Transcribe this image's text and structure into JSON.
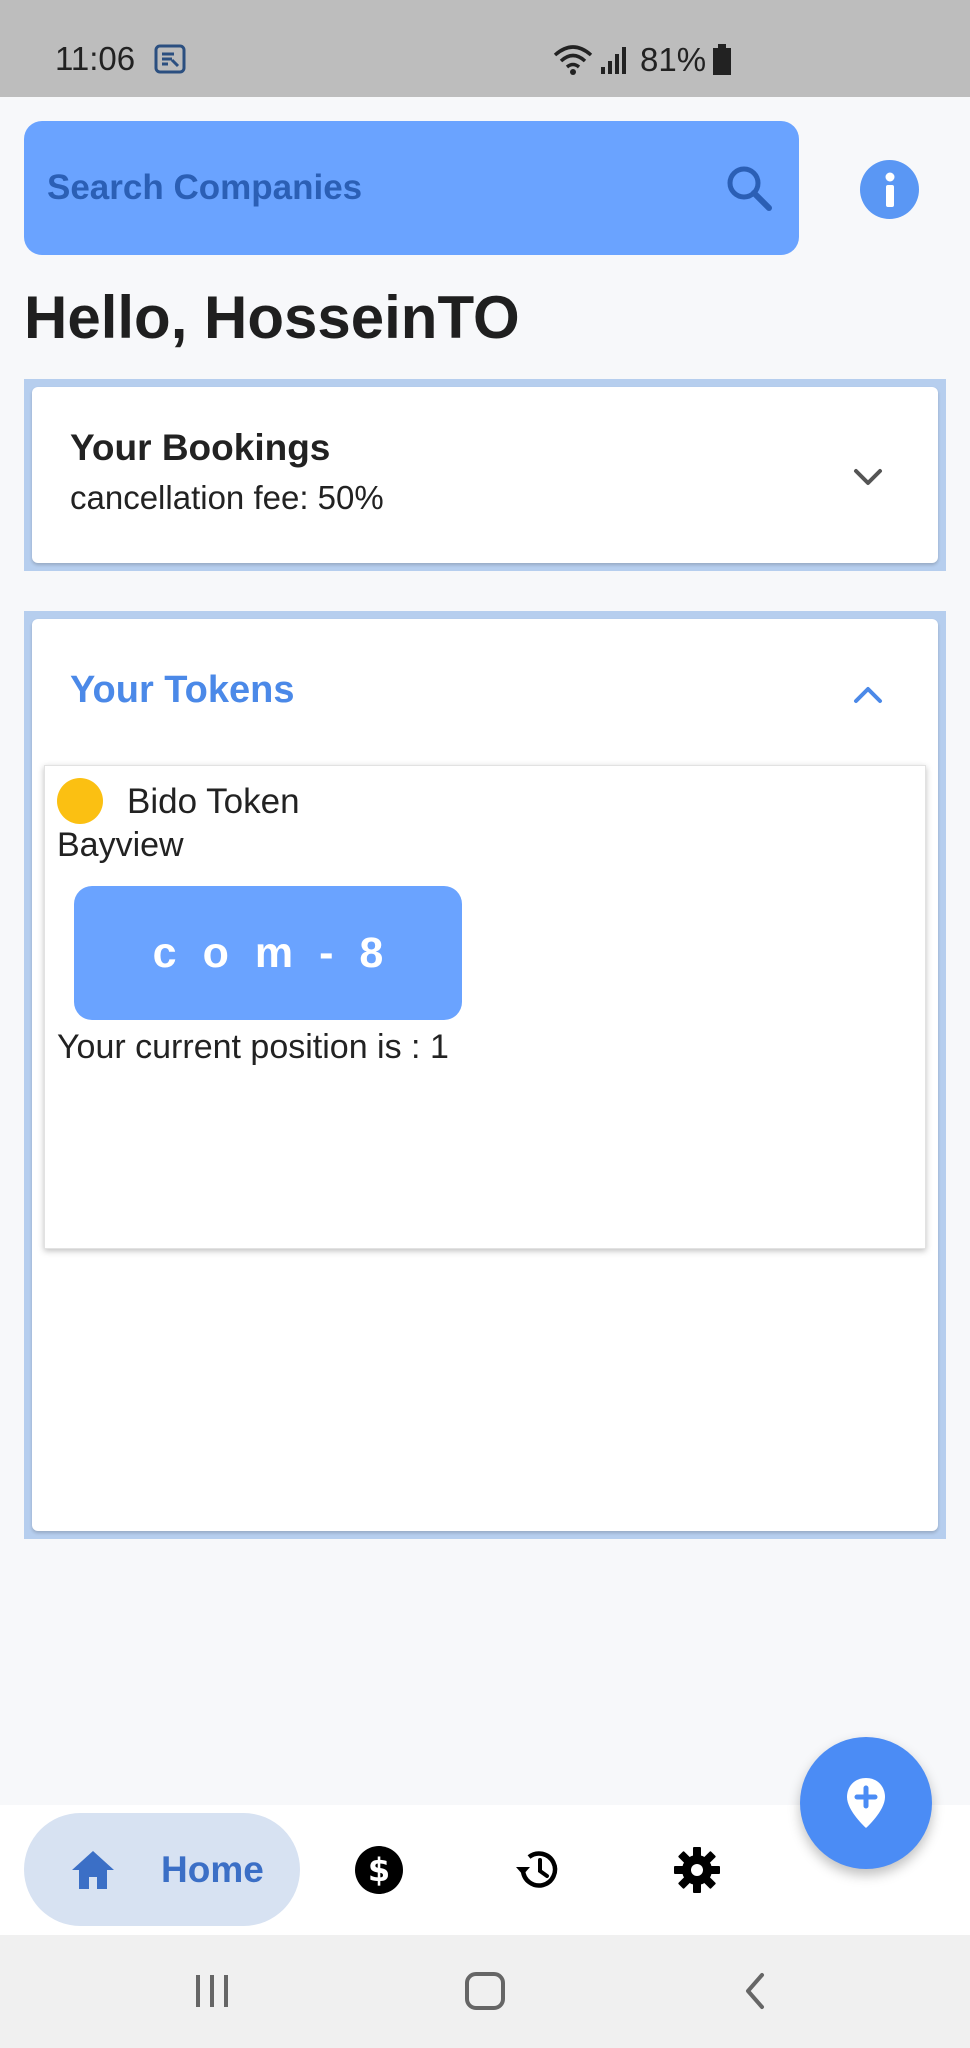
{
  "status_bar": {
    "time": "11:06",
    "battery": "81%"
  },
  "search": {
    "placeholder": "Search Companies"
  },
  "greeting": "Hello, HosseinTO",
  "bookings": {
    "title": "Your Bookings",
    "subtitle": "cancellation fee: 50%"
  },
  "tokens": {
    "title": "Your Tokens",
    "items": [
      {
        "name": "Bido Token",
        "location": "Bayview",
        "code": "com-8",
        "position_text": "Your current position is : 1",
        "dot_color": "#fbc012"
      }
    ]
  },
  "nav": {
    "home_label": "Home",
    "items": [
      "home-icon",
      "dollar-icon",
      "history-icon",
      "settings-icon"
    ]
  },
  "colors": {
    "accent": "#6aa3ff",
    "accent_dark": "#4b89e8",
    "fab": "#4b8cf5"
  }
}
